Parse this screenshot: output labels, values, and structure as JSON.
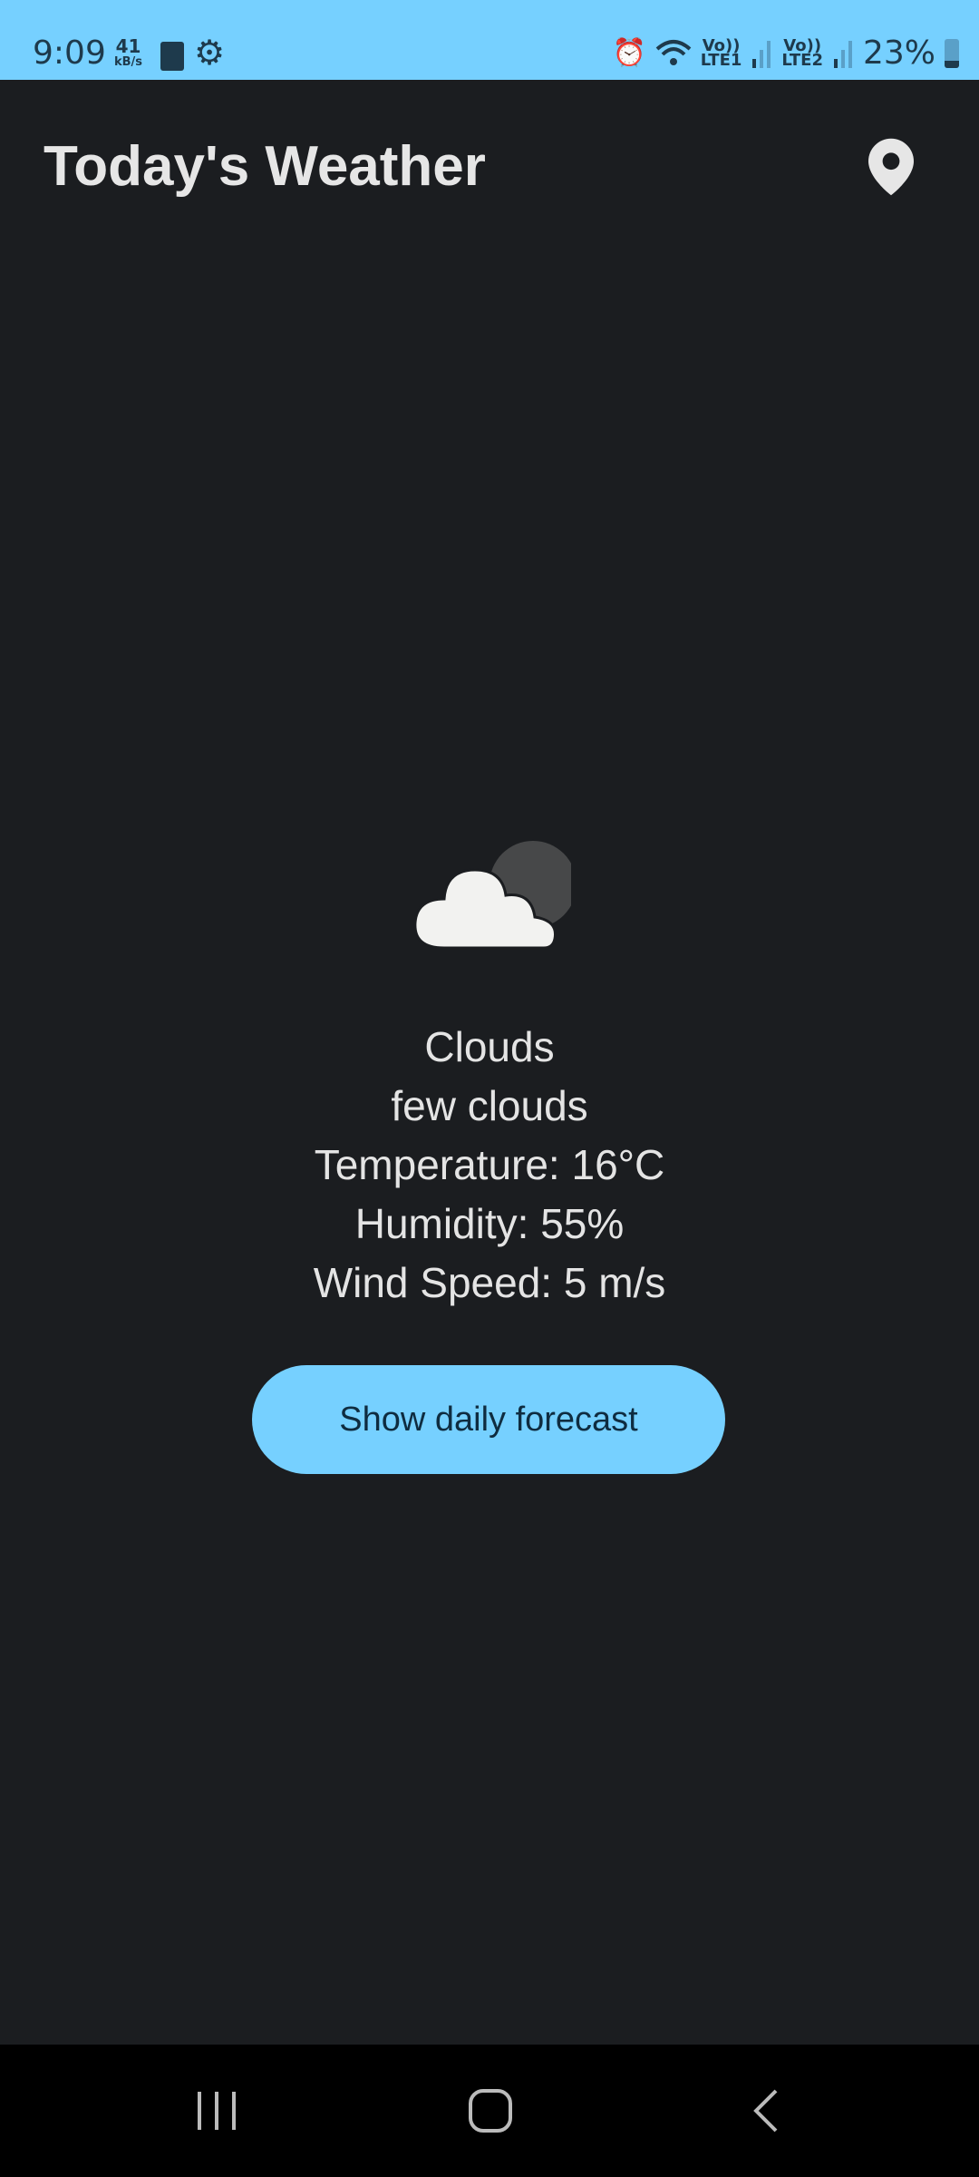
{
  "status_bar": {
    "time": "9:09",
    "net_speed_value": "41",
    "net_speed_unit": "kB/s",
    "sim1_label": "LTE1",
    "sim2_label": "LTE2",
    "volte_label": "Vo))",
    "battery": "23%"
  },
  "header": {
    "title": "Today's Weather",
    "location_icon": "location-pin-icon"
  },
  "weather": {
    "icon": "few-clouds-night-icon",
    "main": "Clouds",
    "description": "few clouds",
    "temperature": "Temperature: 16°C",
    "humidity": "Humidity: 55%",
    "wind": "Wind Speed: 5 m/s"
  },
  "actions": {
    "forecast_label": "Show daily forecast"
  },
  "colors": {
    "accent": "#76d0ff",
    "background": "#1b1d20"
  }
}
